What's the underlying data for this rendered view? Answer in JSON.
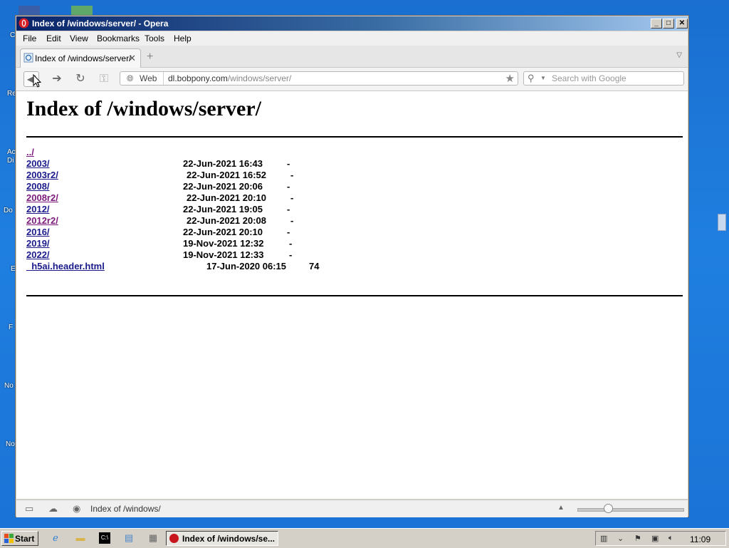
{
  "window": {
    "title": "Index of /windows/server/ - Opera",
    "controls": {
      "minimize": "_",
      "maximize": "□",
      "close": "✕"
    }
  },
  "menu": [
    "File",
    "Edit",
    "View",
    "Bookmarks",
    "Tools",
    "Help"
  ],
  "tab": {
    "label": "Index of /windows/server/",
    "close": "✕",
    "new_tab": "+"
  },
  "toolbar": {
    "web_label": "Web",
    "url_host": "dl.bobpony.com",
    "url_path": "/windows/server/",
    "search_placeholder": "Search with Google"
  },
  "page": {
    "heading": "Index of /windows/server/",
    "entries": [
      {
        "name": "../",
        "date": "",
        "size": "",
        "visited": true
      },
      {
        "name": "2003/",
        "date": "22-Jun-2021 16:43",
        "size": "-",
        "visited": false
      },
      {
        "name": "2003r2/",
        "date": "22-Jun-2021 16:52",
        "size": "-",
        "visited": false
      },
      {
        "name": "2008/",
        "date": "22-Jun-2021 20:06",
        "size": "-",
        "visited": false
      },
      {
        "name": "2008r2/",
        "date": "22-Jun-2021 20:10",
        "size": "-",
        "visited": true
      },
      {
        "name": "2012/",
        "date": "22-Jun-2021 19:05",
        "size": "-",
        "visited": false
      },
      {
        "name": "2012r2/",
        "date": "22-Jun-2021 20:08",
        "size": "-",
        "visited": true
      },
      {
        "name": "2016/",
        "date": "22-Jun-2021 20:10",
        "size": "-",
        "visited": false
      },
      {
        "name": "2019/",
        "date": "19-Nov-2021 12:32",
        "size": "-",
        "visited": false
      },
      {
        "name": "2022/",
        "date": "19-Nov-2021 12:33",
        "size": "-",
        "visited": false
      },
      {
        "name": "_h5ai.header.html",
        "date": "17-Jun-2020 06:15",
        "size": "74",
        "visited": false
      }
    ]
  },
  "status": {
    "text": "Index of /windows/"
  },
  "taskbar": {
    "start_label": "Start",
    "task_label": "Index of /windows/se...",
    "clock": "11:09"
  },
  "desktop_labels": [
    "C",
    "Re",
    "Ac",
    "Di",
    "Do",
    "E",
    "F",
    "No",
    "No"
  ],
  "colors": {
    "link": "#1a1a8c",
    "visited": "#7a1a7a",
    "titlebar": "#0a246a"
  }
}
